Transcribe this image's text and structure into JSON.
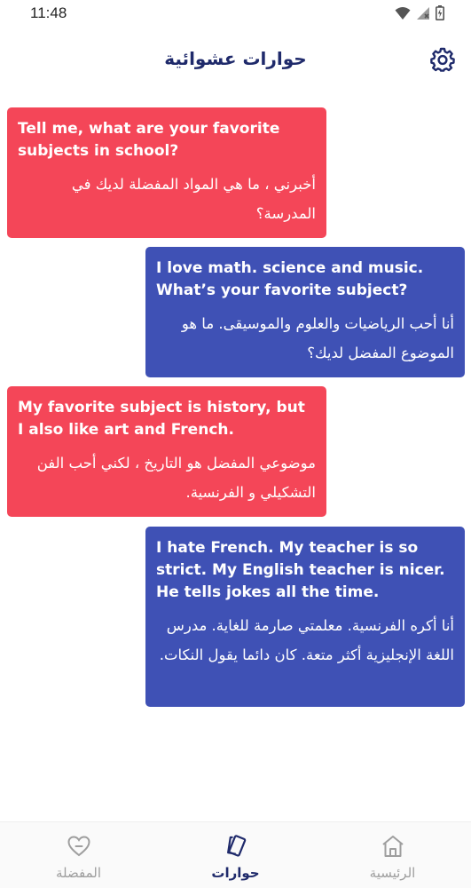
{
  "status_bar": {
    "time": "11:48"
  },
  "header": {
    "title": "حوارات عشوائية",
    "settings_icon": "gear-icon"
  },
  "messages": [
    {
      "side": "left",
      "color": "#f44658",
      "english": "Tell me, what are your favorite subjects in school?",
      "arabic": "أخبرني ، ما هي المواد المفضلة لديك في المدرسة؟"
    },
    {
      "side": "right",
      "color": "#3f51b5",
      "english": "I love math. science and music. What’s your favorite subject?",
      "arabic": "أنا أحب الرياضيات والعلوم والموسيقى. ما هو الموضوع المفضل لديك؟"
    },
    {
      "side": "left",
      "color": "#f44658",
      "english": "My favorite subject is history, but I also like art and French.",
      "arabic": "موضوعي المفضل هو التاريخ ، لكني أحب الفن التشكيلي و الفرنسية."
    },
    {
      "side": "right",
      "color": "#3f51b5",
      "english": "I hate French. My teacher is so strict. My English teacher is nicer. He tells jokes all the time.",
      "arabic": "أنا أكره الفرنسية. معلمتي صارمة للغاية. مدرس اللغة الإنجليزية أكثر متعة. كان دائما يقول النكات."
    }
  ],
  "bottom_nav": {
    "items": [
      {
        "label": "المفضلة",
        "icon": "heart-icon",
        "active": false
      },
      {
        "label": "حوارات",
        "icon": "cards-icon",
        "active": true
      },
      {
        "label": "الرئيسية",
        "icon": "home-icon",
        "active": false
      }
    ]
  },
  "colors": {
    "accent": "#1f2a6b",
    "red_bubble": "#f44658",
    "blue_bubble": "#3f51b5",
    "inactive": "#9e9e9e"
  }
}
